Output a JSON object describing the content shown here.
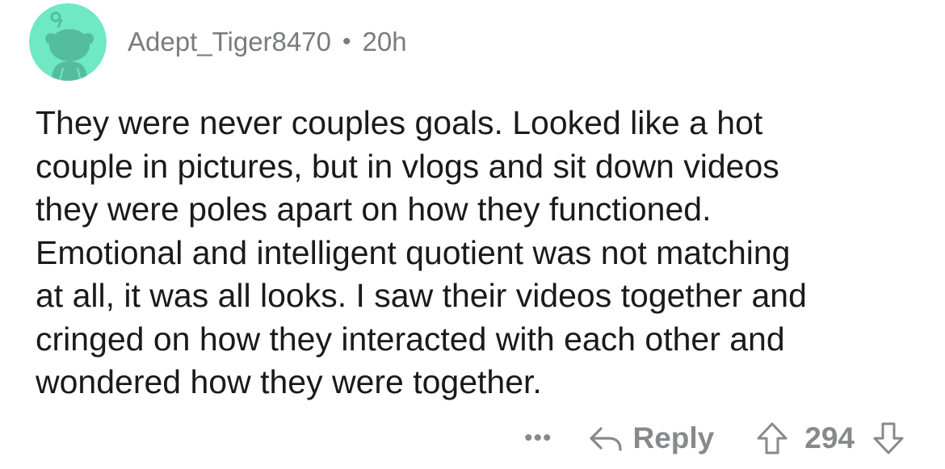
{
  "comment": {
    "author": "Adept_Tiger8470",
    "separator": "•",
    "age": "20h",
    "body_lines": [
      "They were never couples goals. Looked like a hot",
      "couple in pictures, but in vlogs and sit down videos",
      "they were poles apart on how they functioned.",
      "Emotional and intelligent quotient was not matching",
      "at all, it was all looks. I saw their videos together and",
      "cringed on how they interacted with each other and",
      "wondered how they were together."
    ],
    "actions": {
      "more_label": "•••",
      "reply_label": "Reply",
      "vote_count": "294"
    }
  },
  "colors": {
    "avatar_bg": "#6fe8c4",
    "avatar_figure": "#55bd9e",
    "meta_text": "#787c7e",
    "body_text": "#1a1a1b",
    "action_text": "#878a8c"
  },
  "icons": {
    "avatar": "reddit-snoo-avatar",
    "reply": "reply-arrow-icon",
    "upvote": "upvote-arrow-icon",
    "downvote": "downvote-arrow-icon"
  }
}
